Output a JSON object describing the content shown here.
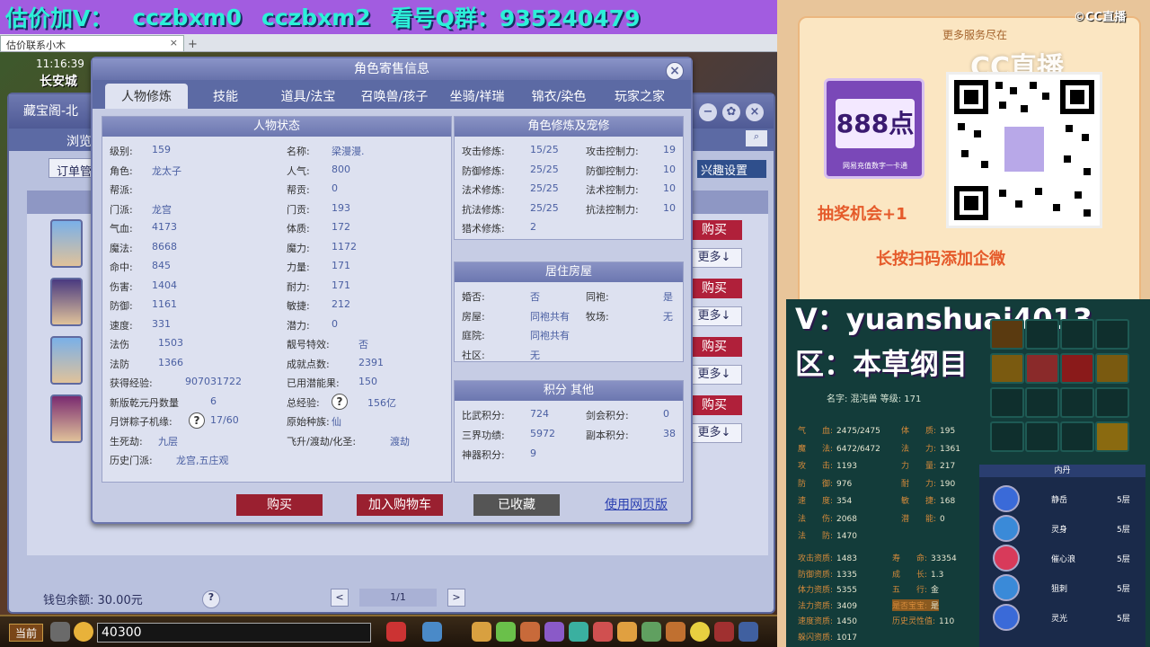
{
  "banner": {
    "texts": [
      "估价加V：",
      "cczbxm0",
      "cczbxm2",
      "看号Q群：935240479"
    ]
  },
  "browser_tab": {
    "label": "估价联系小木",
    "close": "×",
    "new": "+"
  },
  "game": {
    "clock": "11:16:39",
    "location": "长安城"
  },
  "back_window": {
    "title": "藏宝阁-北",
    "subtitle": "浏览",
    "order_btn": "订单管",
    "interest_btn": "兴趣设置",
    "buy_label": "购买",
    "more_label": "更多↓",
    "wallet": "钱包余额: 30.00元",
    "help": "?",
    "page": "1/1",
    "prev": "<",
    "next": ">",
    "ctrl_min": "−",
    "ctrl_max": "✿",
    "ctrl_close": "×",
    "search_icon": "⌕"
  },
  "dialog": {
    "title": "角色寄售信息",
    "close": "×",
    "tabs": [
      "人物修炼",
      "技能",
      "道具/法宝",
      "召唤兽/孩子",
      "坐骑/祥瑞",
      "锦衣/染色",
      "玩家之家"
    ],
    "status": {
      "header": "人物状态",
      "left": [
        {
          "label": "级别:",
          "value": "159"
        },
        {
          "label": "角色:",
          "value": "龙太子"
        },
        {
          "label": "帮派:",
          "value": ""
        },
        {
          "label": "门派:",
          "value": "龙宫"
        },
        {
          "label": "气血:",
          "value": "4173"
        },
        {
          "label": "魔法:",
          "value": "8668"
        },
        {
          "label": "命中:",
          "value": "845"
        },
        {
          "label": "伤害:",
          "value": "1404"
        },
        {
          "label": "防御:",
          "value": "1161"
        },
        {
          "label": "速度:",
          "value": "331"
        },
        {
          "label": "法伤",
          "value": "1503"
        },
        {
          "label": "法防",
          "value": "1366"
        },
        {
          "label": "获得经验:",
          "value": "907031722"
        },
        {
          "label": "新版乾元丹数量",
          "value": "6"
        },
        {
          "label": "月饼粽子机缘:",
          "value": "17/60"
        },
        {
          "label": "生死劫:",
          "value": "九层"
        },
        {
          "label": "历史门派:",
          "value": "龙宫,五庄观"
        }
      ],
      "right": [
        {
          "label": "名称:",
          "value": "梁漫漫."
        },
        {
          "label": "人气:",
          "value": "800"
        },
        {
          "label": "帮贡:",
          "value": "0"
        },
        {
          "label": "门贡:",
          "value": "193"
        },
        {
          "label": "体质:",
          "value": "172"
        },
        {
          "label": "魔力:",
          "value": "1172"
        },
        {
          "label": "力量:",
          "value": "171"
        },
        {
          "label": "耐力:",
          "value": "171"
        },
        {
          "label": "敏捷:",
          "value": "212"
        },
        {
          "label": "潜力:",
          "value": "0"
        },
        {
          "label": "靓号特效:",
          "value": "否"
        },
        {
          "label": "成就点数:",
          "value": "2391"
        },
        {
          "label": "已用潜能果:",
          "value": "150"
        },
        {
          "label": "总经验:",
          "value": "156亿"
        },
        {
          "label": "原始种族:",
          "value": "仙"
        },
        {
          "label": "飞升/渡劫/化圣:",
          "value": "渡劫"
        }
      ]
    },
    "cultivation": {
      "header": "角色修炼及宠修",
      "rows": [
        {
          "l1": "攻击修炼:",
          "v1": "15/25",
          "l2": "攻击控制力:",
          "v2": "19"
        },
        {
          "l1": "防御修炼:",
          "v1": "25/25",
          "l2": "防御控制力:",
          "v2": "10"
        },
        {
          "l1": "法术修炼:",
          "v1": "25/25",
          "l2": "法术控制力:",
          "v2": "10"
        },
        {
          "l1": "抗法修炼:",
          "v1": "25/25",
          "l2": "抗法控制力:",
          "v2": "10"
        },
        {
          "l1": "猎术修炼:",
          "v1": "2",
          "l2": "",
          "v2": ""
        }
      ]
    },
    "house": {
      "header": "居住房屋",
      "rows": [
        {
          "l1": "婚否:",
          "v1": "否",
          "l2": "同袍:",
          "v2": "是"
        },
        {
          "l1": "房屋:",
          "v1": "同袍共有",
          "l2": "牧场:",
          "v2": "无"
        },
        {
          "l1": "庭院:",
          "v1": "同袍共有",
          "l2": "",
          "v2": ""
        },
        {
          "l1": "社区:",
          "v1": "无",
          "l2": "",
          "v2": ""
        }
      ]
    },
    "points": {
      "header": "积分 其他",
      "rows": [
        {
          "l1": "比武积分:",
          "v1": "724",
          "l2": "剑会积分:",
          "v2": "0"
        },
        {
          "l1": "三界功绩:",
          "v1": "5972",
          "l2": "副本积分:",
          "v2": "38"
        },
        {
          "l1": "神器积分:",
          "v1": "9",
          "l2": "",
          "v2": ""
        }
      ]
    },
    "buttons": {
      "buy": "购买",
      "cart": "加入购物车",
      "fav": "已收藏",
      "web": "使用网页版"
    },
    "qm": "?"
  },
  "bottombar": {
    "current": "当前",
    "input": "40300"
  },
  "promo": {
    "header": "更多服务尽在",
    "cc": "©CC直播",
    "cc_big": "CC直播",
    "card_points": "888点",
    "card_sub": "网易充值数字一卡通",
    "lottery": "抽奖机会+1",
    "scan": "长按扫码添加企微"
  },
  "overlay": {
    "v": "V：yuanshuai4013",
    "q": "区：本草纲目"
  },
  "pet": {
    "name": "名字: 混沌兽  等级: 171",
    "stats_left": [
      [
        "气　　血:",
        "2475/2475"
      ],
      [
        "魔　　法:",
        "6472/6472"
      ],
      [
        "攻　　击:",
        "1193"
      ],
      [
        "防　　御:",
        "976"
      ],
      [
        "速　　度:",
        "354"
      ],
      [
        "法　　伤:",
        "2068"
      ],
      [
        "法　　防:",
        "1470"
      ]
    ],
    "stats_right": [
      [
        "体　　质:",
        "195"
      ],
      [
        "法　　力:",
        "1361"
      ],
      [
        "力　　量:",
        "217"
      ],
      [
        "耐　　力:",
        "190"
      ],
      [
        "敏　　捷:",
        "168"
      ],
      [
        "潜　　能:",
        "0"
      ]
    ],
    "apt_left": [
      [
        "攻击资质:",
        "1483"
      ],
      [
        "防御资质:",
        "1335"
      ],
      [
        "体力资质:",
        "5355"
      ],
      [
        "法力资质:",
        "3409"
      ],
      [
        "速度资质:",
        "1450"
      ],
      [
        "躲闪资质:",
        "1017"
      ]
    ],
    "apt_right": [
      [
        "寿　　命:",
        "33354"
      ],
      [
        "成　　长:",
        "1.3"
      ],
      [
        "五　　行:",
        "金"
      ],
      [
        "是否宝宝:",
        "是"
      ],
      [
        "历史灵性值:",
        "110"
      ]
    ],
    "inner_header": "内丹",
    "skills": [
      {
        "name": "静岳",
        "level": "5层"
      },
      {
        "name": "灵身",
        "level": "5层"
      },
      {
        "name": "催心浪",
        "level": "5层"
      },
      {
        "name": "狙刺",
        "level": "5层"
      },
      {
        "name": "灵光",
        "level": "5层"
      }
    ]
  }
}
